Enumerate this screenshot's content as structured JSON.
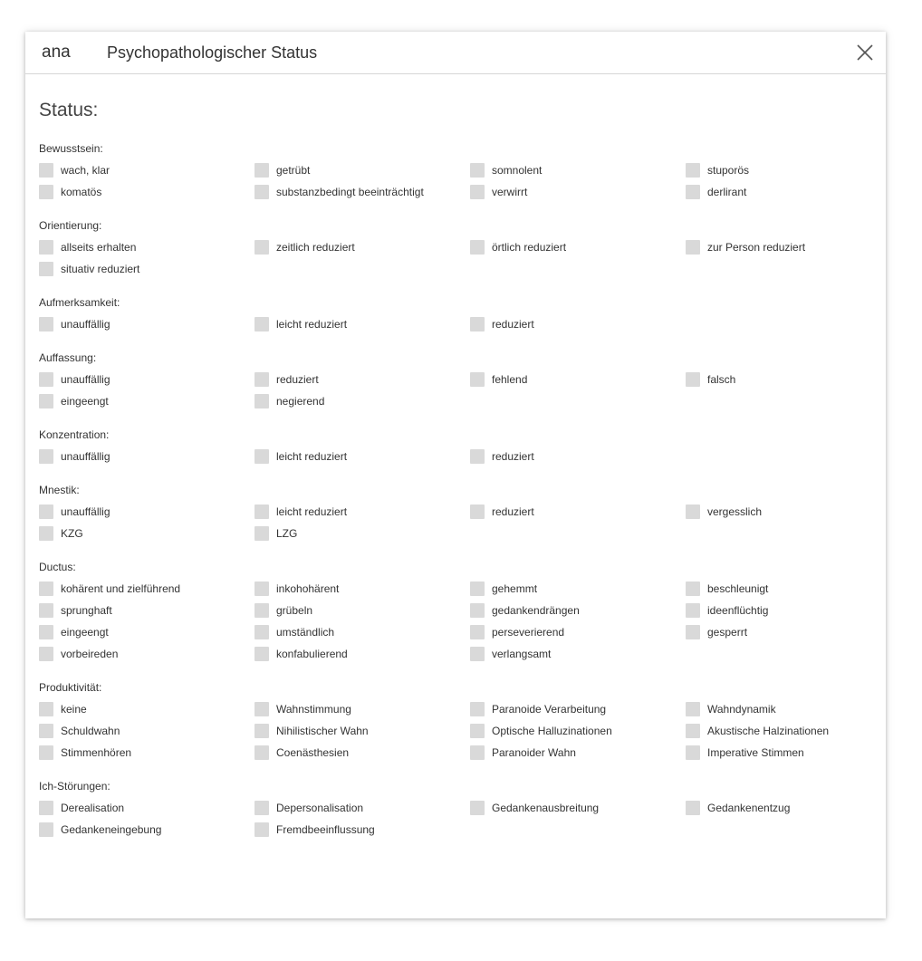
{
  "header": {
    "brand": "ana",
    "title": "Psychopathologischer Status"
  },
  "status_heading": "Status:",
  "sections": [
    {
      "label": "Bewusstsein:",
      "options": [
        "wach, klar",
        "getrübt",
        "somnolent",
        "stuporös",
        "komatös",
        "substanzbedingt beeinträchtigt",
        "verwirrt",
        "derlirant"
      ]
    },
    {
      "label": "Orientierung:",
      "options": [
        "allseits erhalten",
        "zeitlich reduziert",
        "örtlich reduziert",
        "zur Person reduziert",
        "situativ reduziert"
      ]
    },
    {
      "label": "Aufmerksamkeit:",
      "options": [
        "unauffällig",
        "leicht reduziert",
        "reduziert"
      ]
    },
    {
      "label": "Auffassung:",
      "options": [
        "unauffällig",
        "reduziert",
        "fehlend",
        "falsch",
        "eingeengt",
        "negierend"
      ]
    },
    {
      "label": "Konzentration:",
      "options": [
        "unauffällig",
        "leicht reduziert",
        "reduziert"
      ]
    },
    {
      "label": "Mnestik:",
      "options": [
        "unauffällig",
        "leicht reduziert",
        "reduziert",
        "vergesslich",
        "KZG",
        "LZG"
      ]
    },
    {
      "label": "Ductus:",
      "options": [
        "kohärent und zielführend",
        "inkohohärent",
        "gehemmt",
        "beschleunigt",
        "sprunghaft",
        "grübeln",
        "gedankendrängen",
        "ideenflüchtig",
        "eingeengt",
        "umständlich",
        "perseverierend",
        "gesperrt",
        "vorbeireden",
        "konfabulierend",
        "verlangsamt"
      ]
    },
    {
      "label": "Produktivität:",
      "options": [
        "keine",
        "Wahnstimmung",
        "Paranoide Verarbeitung",
        "Wahndynamik",
        "Schuldwahn",
        "Nihilistischer Wahn",
        "Optische Halluzinationen",
        "Akustische Halzinationen",
        "Stimmenhören",
        "Coenästhesien",
        "Paranoider Wahn",
        "Imperative Stimmen"
      ]
    },
    {
      "label": "Ich-Störungen:",
      "options": [
        "Derealisation",
        "Depersonalisation",
        "Gedankenausbreitung",
        "Gedankenentzug",
        "Gedankeneingebung",
        "Fremdbeeinflussung"
      ]
    }
  ]
}
